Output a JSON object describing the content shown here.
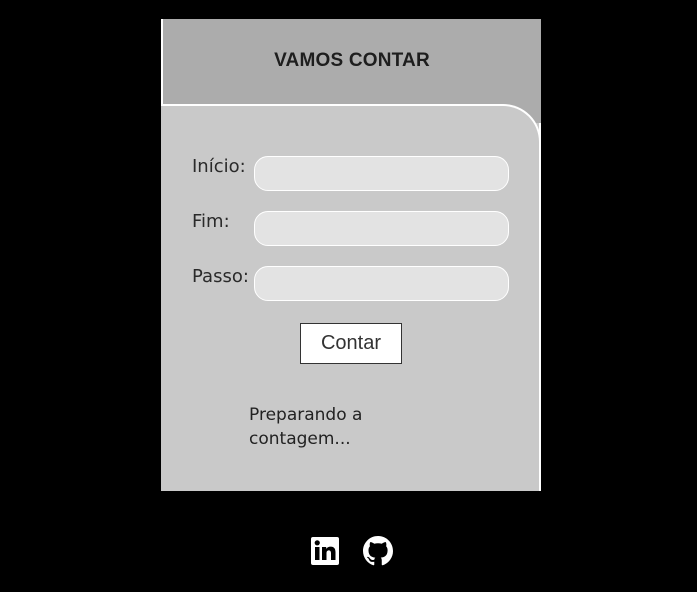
{
  "card": {
    "title": "VAMOS CONTAR"
  },
  "form": {
    "start_label": "Início:",
    "end_label": "Fim:",
    "step_label": "Passo:",
    "start_value": "",
    "end_value": "",
    "step_value": "",
    "submit_label": "Contar"
  },
  "status": {
    "message": "Preparando a contagem..."
  },
  "footer": {
    "icons": [
      "linkedin-icon",
      "github-icon"
    ]
  },
  "colors": {
    "page_background": "#000000",
    "card_header": "#acacac",
    "card_body": "#c9c9c9",
    "input_background": "#e3e3e3",
    "border": "#ffffff"
  }
}
